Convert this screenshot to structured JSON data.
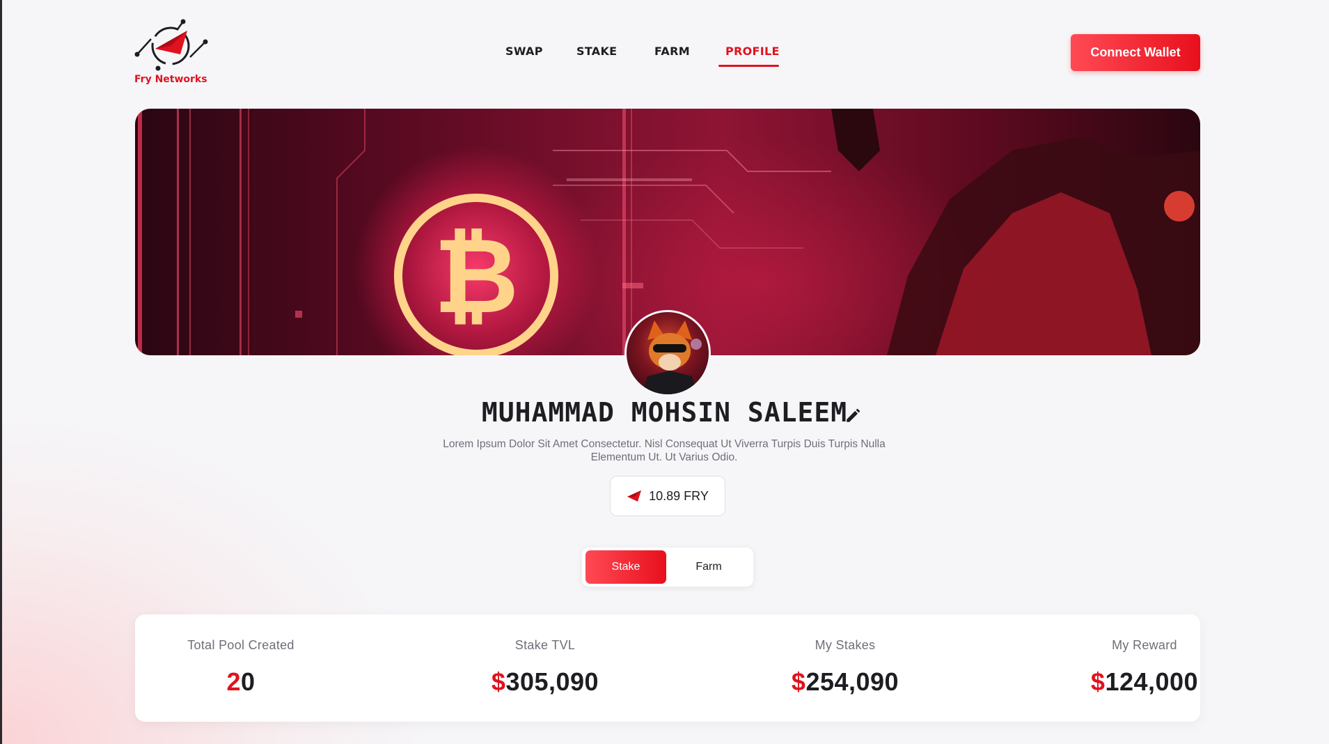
{
  "brand": {
    "name": "Fry Networks",
    "accent": "#e0121d"
  },
  "nav": {
    "items": [
      {
        "label": "SWAP"
      },
      {
        "label": "STAKE"
      },
      {
        "label": "FARM"
      },
      {
        "label": "PROFILE",
        "active": true
      }
    ]
  },
  "header": {
    "connect_label": "Connect Wallet"
  },
  "profile": {
    "name": "MUHAMMAD MOHSIN SALEEM",
    "bio": "Lorem Ipsum Dolor Sit Amet Consectetur. Nisl Consequat Ut Viverra Turpis Duis Turpis Nulla Elementum Ut. Ut Varius Odio.",
    "balance": "10.89 FRY"
  },
  "tabs": [
    {
      "label": "Stake",
      "active": true
    },
    {
      "label": "Farm",
      "active": false
    }
  ],
  "stats": [
    {
      "label": "Total Pool Created",
      "prefix": "2",
      "value": "0"
    },
    {
      "label": "Stake TVL",
      "prefix": "$",
      "value": "305,090"
    },
    {
      "label": "My Stakes",
      "prefix": "$",
      "value": "254,090"
    },
    {
      "label": "My Reward",
      "prefix": "$",
      "value": "124,000"
    }
  ],
  "icons": {
    "logo": "fry-networks-logo-icon",
    "edit": "pencil-icon",
    "token": "fry-token-icon",
    "banner_coin": "bitcoin-icon"
  }
}
